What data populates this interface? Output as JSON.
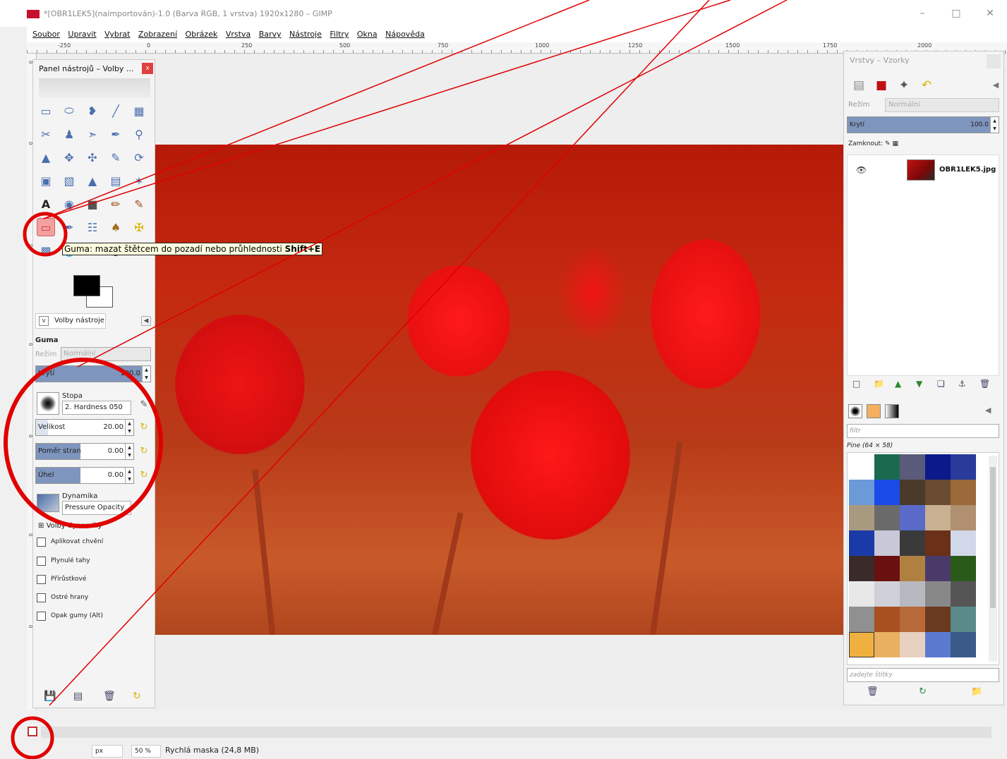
{
  "window": {
    "title": "*[OBR1LEK5](naimportován)-1.0 (Barva RGB, 1 vrstva) 1920x1280 – GIMP",
    "minimize_icon": "minimize-icon",
    "maximize_icon": "maximize-icon",
    "close_icon": "close-icon"
  },
  "menu": [
    "Soubor",
    "Upravit",
    "Vybrat",
    "Zobrazení",
    "Obrázek",
    "Vrstva",
    "Barvy",
    "Nástroje",
    "Filtry",
    "Okna",
    "Nápověda"
  ],
  "ruler_top": [
    "-250",
    "0",
    "250",
    "500",
    "750",
    "1000",
    "1250",
    "1500",
    "1750",
    "2000"
  ],
  "ruler_left": [
    "0",
    "0",
    "0",
    "0",
    "0",
    "0",
    "0"
  ],
  "toolbox": {
    "title": "Panel nástrojů – Volby ...",
    "close_label": "x",
    "tooltip_text": "Guma: mazat štětcem do pozadí nebo průhlednosti",
    "tooltip_shortcut": "Shift+E"
  },
  "tool_options": {
    "tab_label": "Volby nástroje",
    "tool_name": "Guma",
    "mode_label": "Režim",
    "mode_value": "Normální",
    "opacity_label": "Krytí",
    "opacity_value": "100.0",
    "brush_label": "Stopa",
    "brush_value": "2. Hardness 050",
    "size_label": "Velikost",
    "size_value": "20.00",
    "ratio_label": "Poměr stran",
    "ratio_value": "0.00",
    "angle_label": "Úhel",
    "angle_value": "0.00",
    "dynamics_label": "Dynamika",
    "dynamics_value": "Pressure Opacity",
    "dynamics_options": "Volby dynamiky",
    "checkboxes": [
      "Aplikovat chvění",
      "Plynulé tahy",
      "Přírůstkové",
      "Ostré hrany",
      "Opak gumy (Alt)"
    ]
  },
  "dock": {
    "title": "Vrstvy – Vzorky",
    "mode_label": "Režim",
    "mode_value": "Normální",
    "opacity_label": "Krytí",
    "opacity_value": "100.0",
    "lock_label": "Zamknout:",
    "layer_name": "OBR1LEK5.jpg",
    "filter_placeholder": "filtr",
    "pattern_name": "Pine (64 × 58)",
    "tags_placeholder": "zadejte štítky"
  },
  "status": {
    "unit": "px",
    "zoom": "50 %",
    "message": "Rychlá maska (24,8 MB)"
  },
  "colors": {
    "annotation": "#e00000",
    "slider_fill": "#7e95bd"
  }
}
